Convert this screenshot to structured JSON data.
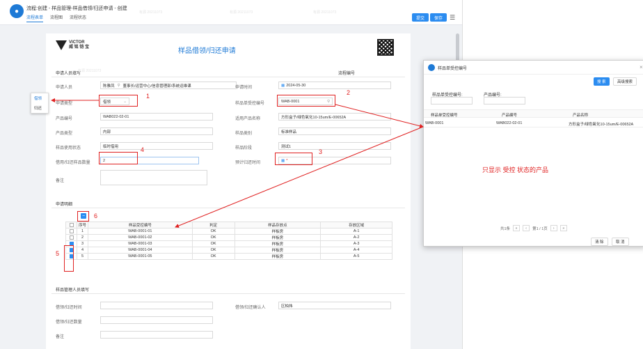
{
  "app": {
    "title": "流程:创建 - 样品管理-样品借领/归还申请 - 创建",
    "tabs": [
      "流程表单",
      "流程图",
      "流程状态"
    ],
    "submit_label": "提交",
    "save_label": "保存",
    "menu_icon": "menu-icon"
  },
  "doc": {
    "brand_line1": "VICTOR",
    "brand_line2": "威 铭 铠 宝",
    "title": "样品借领/归还申请",
    "section_applicant": "申请人员填写",
    "flow_number_label": "流程编号",
    "applicant_label": "申请人员",
    "applicant_value": "陈雅凤",
    "dept_value": "董事长/运营中心/信息管理部/系统运维课",
    "apply_time_label": "申请时间",
    "apply_time_value": "2024-05-30",
    "apply_type_label": "申请类型",
    "apply_type_value": "借领",
    "sample_no_label": "样品单受控编号",
    "sample_no_value": "WAB-0001",
    "product_no_label": "产品编号",
    "product_no_value": "WAB022-02-01",
    "product_name_label": "适用产品名称",
    "product_name_value": "方形盒子/绿色氧化10-15um/E-00652A",
    "product_type_label": "产品类型",
    "product_type_value": "内部",
    "sample_type_label": "样品类别",
    "sample_type_value": "标准样品",
    "usage_status_label": "样品使用状态",
    "usage_status_value": "临时借用",
    "sample_stage_label": "样品阶段",
    "sample_stage_value": "测试1",
    "qty_label": "借用/归还样品数量",
    "qty_value": "2",
    "return_time_label": "预计归还时间",
    "remark_label": "备注",
    "section_detail": "申请明细",
    "section_admin": "样品管理人员填写",
    "admin_time_label": "借领/归还时间",
    "admin_confirm_label": "借领/归还确认人",
    "admin_confirm_value": "区柏炜",
    "admin_qty_label": "借领/归还数量",
    "admin_remark_label": "备注"
  },
  "dropdown": {
    "options": [
      "借领",
      "归还"
    ]
  },
  "table": {
    "headers": [
      "序号",
      "样品受控编号",
      "判定",
      "样品存放点",
      "存放区域"
    ],
    "rows": [
      {
        "no": "1",
        "code": "WAB-0001-01",
        "judge": "OK",
        "place": "样板房",
        "area": "A-1",
        "checked": false
      },
      {
        "no": "2",
        "code": "WAB-0001-02",
        "judge": "OK",
        "place": "样板房",
        "area": "A-2",
        "checked": false
      },
      {
        "no": "3",
        "code": "WAB-0001-03",
        "judge": "OK",
        "place": "样板房",
        "area": "A-3",
        "checked": true
      },
      {
        "no": "4",
        "code": "WAB-0001-04",
        "judge": "OK",
        "place": "样板房",
        "area": "A-4",
        "checked": true
      },
      {
        "no": "5",
        "code": "WAB-0001-05",
        "judge": "OK",
        "place": "样板房",
        "area": "A-5",
        "checked": true
      }
    ]
  },
  "annotations": [
    "1",
    "2",
    "3",
    "4",
    "5",
    "6"
  ],
  "modal": {
    "title": "样品单受控编号",
    "search_label": "搜 索",
    "advanced_label": "高级搜索",
    "filter1_label": "样品单受控编号:",
    "filter2_label": "产品编号:",
    "col1": "样品单受控编号",
    "col2": "产品编号",
    "col3": "产品名称",
    "row_code": "WAB-0001",
    "row_product_no": "WAB022-02-01",
    "row_product_name": "方形盒子/绿色氧化10-15um/E-00652A",
    "note": "只显示 受控 状态的产品",
    "pager_total": "共1条",
    "pager_page": "第1 / 1页",
    "clear_label": "清 除",
    "cancel_label": "取 消"
  },
  "colors": {
    "accent": "#2b8cf0",
    "annotation": "#e02020"
  }
}
